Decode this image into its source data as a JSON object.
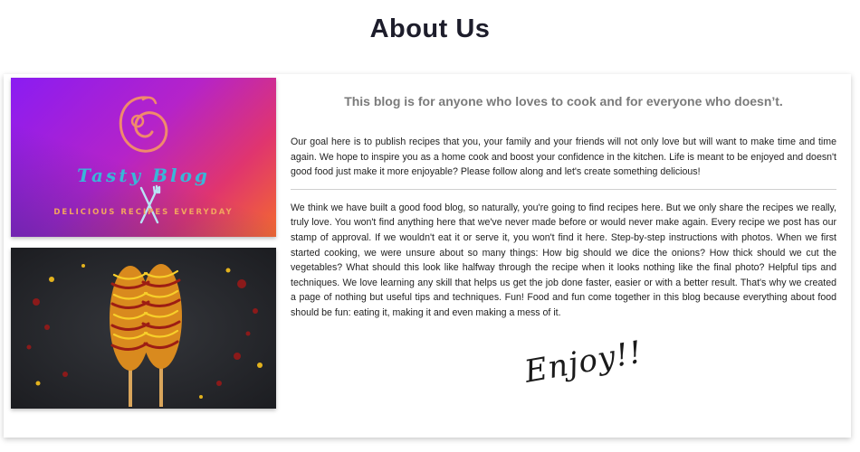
{
  "page": {
    "title": "About Us"
  },
  "logo": {
    "brand_name": "Tasty Blog",
    "tagline": "DELICIOUS RECIPES EVERYDAY"
  },
  "content": {
    "subtitle": "This blog is for anyone who loves to cook and for everyone who doesn’t.",
    "paragraph1": "Our goal here is to publish recipes that you, your family and your friends will not only love but will want to make time and time again. We hope to inspire you as a home cook and boost your confidence in the kitchen. Life is meant to be enjoyed and doesn't good food just make it more enjoyable? Please follow along and let's create something delicious!",
    "paragraph2": "We think we have built a good food blog, so naturally, you're going to find recipes here. But we only share the recipes we really, truly love. You won't find anything here that we've never made before or would never make again. Every recipe we post has our stamp of approval. If we wouldn't eat it or serve it, you won't find it here. Step-by-step instructions with photos. When we first started cooking, we were unsure about so many things: How big should we dice the onions? How thick should we cut the vegetables? What should this look like halfway through the recipe when it looks nothing like the final photo? Helpful tips and techniques. We love learning any skill that helps us get the job done faster, easier or with a better result. That's why we created a page of nothing but useful tips and techniques. Fun! Food and fun come together in this blog because everything about food should be fun: eating it, making it and even making a mess of it.",
    "signoff": "Enjoy!!"
  },
  "colors": {
    "title": "#1d1d2b",
    "subtitle": "#7a7a7a",
    "logo_gradient_start": "#8a1cf2",
    "logo_gradient_end": "#f36a2e",
    "logo_text": "#39b6d8",
    "tagline": "#f2a55e"
  },
  "icons": {
    "logo_mark": "swirl-icon",
    "logo_utensils": "fork-knife-icon"
  }
}
